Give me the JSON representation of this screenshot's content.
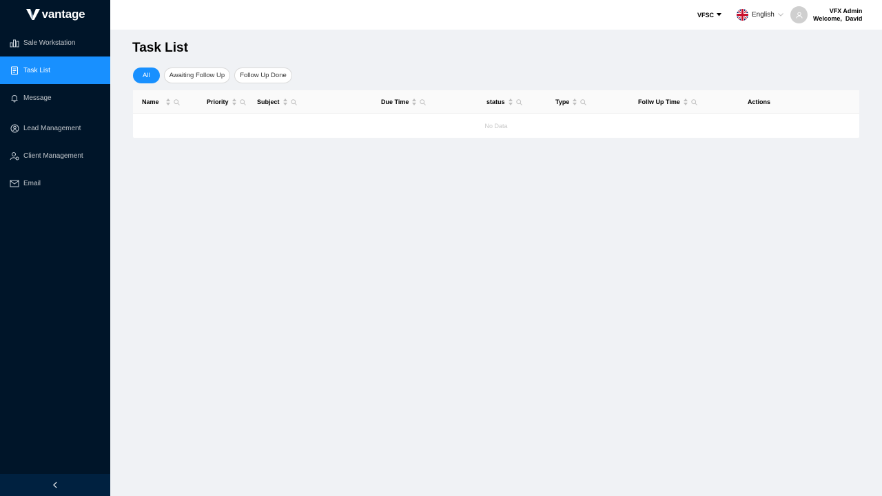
{
  "brand": {
    "name": "vantage"
  },
  "sidebar": {
    "items": [
      {
        "label": "Sale Workstation",
        "icon": "bar-chart-icon"
      },
      {
        "label": "Task List",
        "icon": "task-list-icon",
        "active": true
      },
      {
        "label": "Message",
        "icon": "bell-icon"
      },
      {
        "label": "Lead Management",
        "icon": "lead-icon"
      },
      {
        "label": "Client Management",
        "icon": "client-icon"
      },
      {
        "label": "Email",
        "icon": "mail-icon"
      }
    ],
    "collapse_icon": "chevron-left-icon"
  },
  "header": {
    "entity": "VFSC",
    "language": "English",
    "user_role": "VFX Admin",
    "welcome": "Welcome,  David"
  },
  "page": {
    "title": "Task List",
    "tabs": [
      {
        "label": "All",
        "active": true
      },
      {
        "label": "Awaiting Follow Up"
      },
      {
        "label": "Follow Up Done"
      }
    ]
  },
  "table": {
    "columns": [
      {
        "label": "Name",
        "sortable": true,
        "filterable": true
      },
      {
        "label": "Priority",
        "sortable": true,
        "filterable": true
      },
      {
        "label": "Subject",
        "sortable": true,
        "filterable": true
      },
      {
        "label": "Due Time",
        "sortable": true,
        "filterable": true
      },
      {
        "label": "status",
        "sortable": true,
        "filterable": true
      },
      {
        "label": "Type",
        "sortable": true,
        "filterable": true
      },
      {
        "label": "Follw Up Time",
        "sortable": true,
        "filterable": true
      },
      {
        "label": "Actions",
        "sortable": false,
        "filterable": false
      }
    ],
    "empty_text": "No Data"
  },
  "colors": {
    "primary": "#1890ff",
    "sidebar_bg": "#001529",
    "page_bg": "#f0f2f5"
  }
}
